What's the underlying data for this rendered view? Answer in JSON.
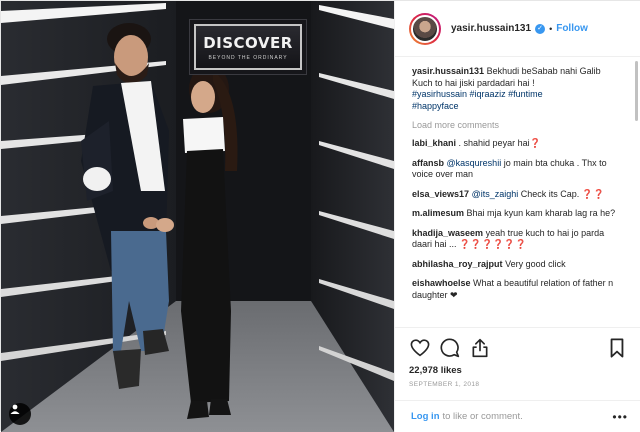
{
  "photo": {
    "sign_title": "DISCOVER",
    "sign_subtitle": "BEYOND THE ORDINARY",
    "user_tag_icon": "person-silhouette-icon"
  },
  "header": {
    "username": "yasir.hussain131",
    "verified_icon": "verified-badge-icon",
    "separator": "•",
    "follow_label": "Follow",
    "accent": "#3897f0"
  },
  "caption": {
    "username": "yasir.hussain131",
    "line1": "Bekhudi beSabab nahi Galib",
    "line2": "Kuch to hai jiski pardadari hai !",
    "hashtags": [
      "#yasirhussain",
      "#iqraaziz",
      "#funtime",
      "#happyface"
    ]
  },
  "load_more": "Load more comments",
  "comments": [
    {
      "user": "labi_khani",
      "text": ". shahid peyar hai❓"
    },
    {
      "user": "affansb",
      "mention": "@kasqureshii",
      "text": " jo main bta chuka . Thx to voice over man"
    },
    {
      "user": "elsa_views17",
      "mention": "@its_zaighi",
      "text": " Check its Cap. ❓❓"
    },
    {
      "user": "m.alimesum",
      "text": "Bhai mja kyun kam kharab lag ra he?"
    },
    {
      "user": "khadija_waseem",
      "text": "yeah true kuch to hai jo parda daari hai ... ❓❓❓❓❓❓"
    },
    {
      "user": "abhilasha_roy_rajput",
      "text": "Very good click"
    },
    {
      "user": "eishawhoelse",
      "text": "What a beautiful relation of father n daughter ❤"
    }
  ],
  "actions": {
    "like_icon": "heart-icon",
    "comment_icon": "comment-bubble-icon",
    "share_icon": "share-icon",
    "save_icon": "bookmark-icon"
  },
  "likes": "22,978 likes",
  "date": "SEPTEMBER 1, 2018",
  "footer": {
    "login_label": "Log in",
    "rest_text": "to like or comment.",
    "more_label": "•••"
  }
}
